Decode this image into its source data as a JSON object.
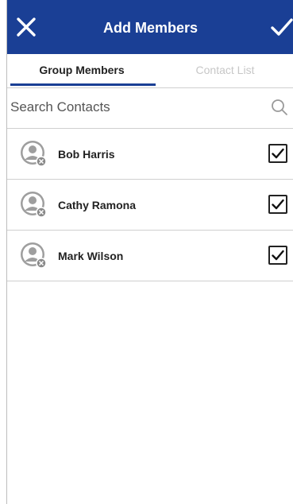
{
  "header": {
    "title": "Add Members",
    "background": "#1a3f95",
    "close_icon": "close-icon",
    "confirm_icon": "checkmark-icon"
  },
  "tabs": [
    {
      "label": "Group Members",
      "active": true
    },
    {
      "label": "Contact List",
      "active": false
    }
  ],
  "search": {
    "placeholder": "Search Contacts",
    "value": "",
    "icon": "search-icon"
  },
  "members": [
    {
      "name": "Bob Harris",
      "checked": true
    },
    {
      "name": "Cathy Ramona",
      "checked": true
    },
    {
      "name": "Mark Wilson",
      "checked": true
    }
  ]
}
